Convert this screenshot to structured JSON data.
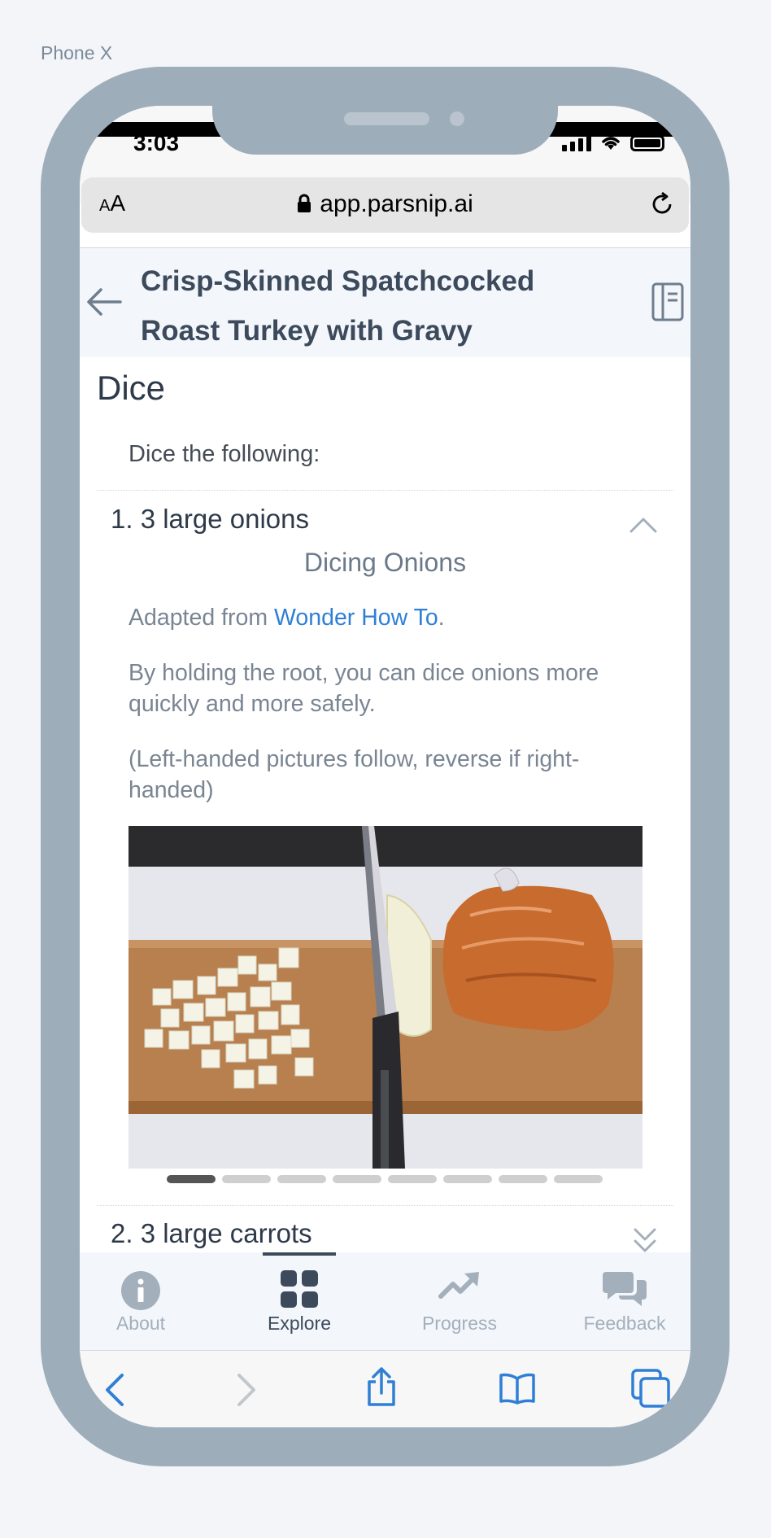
{
  "device": {
    "label": "Phone X"
  },
  "status": {
    "time": "3:03"
  },
  "browser": {
    "aa_small": "A",
    "aa_large": "A",
    "url": "app.parsnip.ai"
  },
  "header": {
    "title": "Crisp-Skinned Spatchcocked Roast Turkey with Gravy"
  },
  "content": {
    "section_title": "Dice",
    "intro": "Dice the following:",
    "step1": {
      "label": "1. 3 large onions",
      "subtitle": "Dicing Onions",
      "adapted_prefix": "Adapted from ",
      "adapted_link": "Wonder How To",
      "adapted_suffix": ".",
      "para1": "By holding the root, you can dice onions more quickly and more safely.",
      "para2": "(Left-handed pictures follow, reverse if right-handed)",
      "carousel": {
        "slides": 8,
        "active_index": 0
      }
    },
    "step2": {
      "label": "2. 3 large carrots"
    }
  },
  "tabs": [
    {
      "label": "About",
      "icon": "info-icon",
      "active": false
    },
    {
      "label": "Explore",
      "icon": "grid-icon",
      "active": true
    },
    {
      "label": "Progress",
      "icon": "trend-icon",
      "active": false
    },
    {
      "label": "Feedback",
      "icon": "chat-icon",
      "active": false
    }
  ],
  "colors": {
    "accent": "#2f7fd6",
    "frame": "#9eadba",
    "title": "#3c4a5c"
  }
}
